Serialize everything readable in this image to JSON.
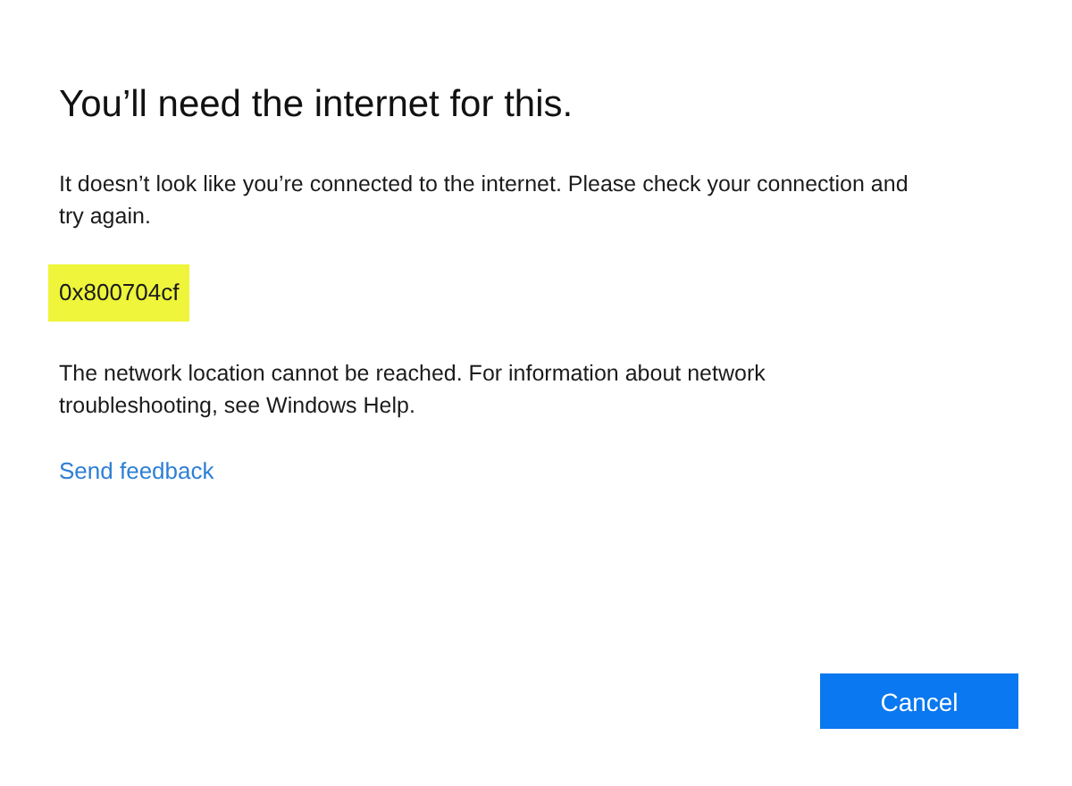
{
  "title": "You’ll need the internet for this.",
  "message": "It doesn’t look like you’re connected to the internet. Please check your connection and try again.",
  "error_code": {
    "text": "0x800704cf",
    "highlighted": true
  },
  "detail": "The network location cannot be reached. For information about network troubleshooting, see Windows Help.",
  "link": "Send feedback",
  "buttons": [
    "Cancel"
  ]
}
